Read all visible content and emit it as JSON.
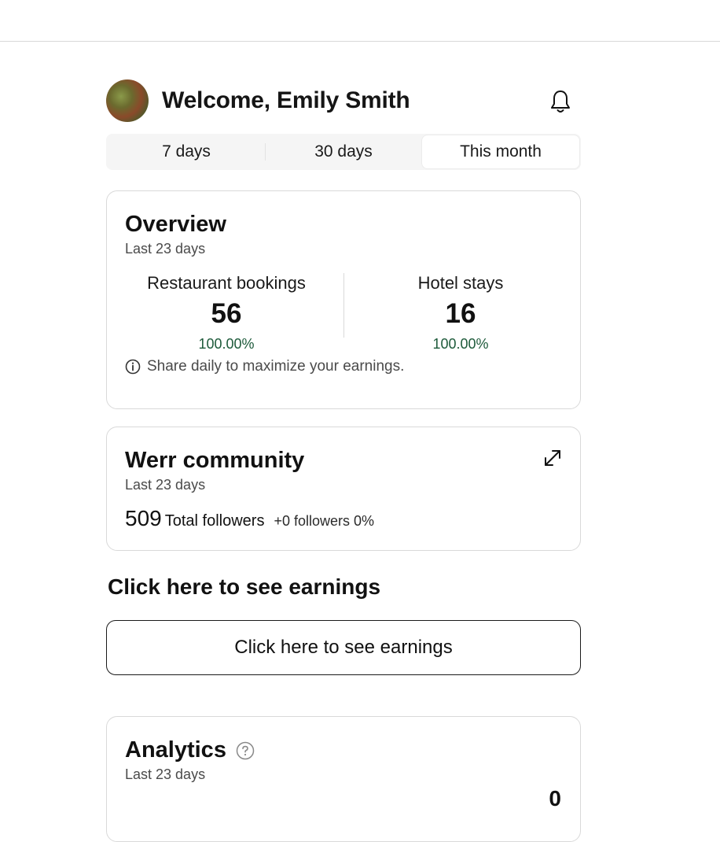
{
  "header": {
    "welcome": "Welcome, Emily Smith"
  },
  "tabs": [
    {
      "label": "7 days",
      "active": false
    },
    {
      "label": "30 days",
      "active": false
    },
    {
      "label": "This month",
      "active": true
    }
  ],
  "overview": {
    "title": "Overview",
    "subtitle": "Last 23 days",
    "stats": [
      {
        "label": "Restaurant bookings",
        "value": "56",
        "pct": "100.00%"
      },
      {
        "label": "Hotel stays",
        "value": "16",
        "pct": "100.00%"
      }
    ],
    "tip": "Share daily to maximize your earnings."
  },
  "community": {
    "title": "Werr community",
    "subtitle": "Last 23 days",
    "followers_count": "509",
    "followers_label": "Total followers",
    "followers_delta": "+0 followers 0%"
  },
  "earnings": {
    "heading": "Click here to see earnings",
    "button_label": "Click here to see earnings"
  },
  "analytics": {
    "title": "Analytics",
    "subtitle": "Last 23 days",
    "value": "0"
  },
  "colors": {
    "positive": "#1d5a3a",
    "border": "#d9d9d9"
  }
}
